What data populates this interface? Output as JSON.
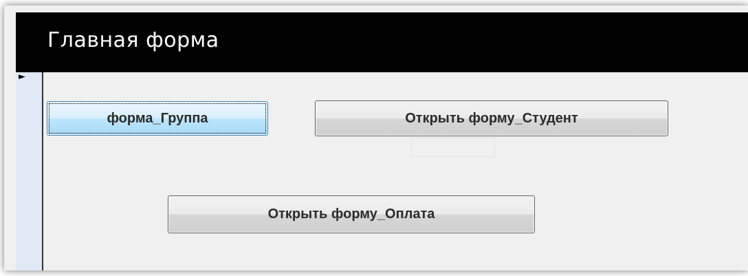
{
  "form": {
    "title": "Главная форма",
    "record_selector_icon": "triangle-right-icon"
  },
  "buttons": {
    "group": "форма_Группа",
    "student": "Открыть форму_Студент",
    "payment": "Открыть форму_Оплата"
  },
  "colors": {
    "header_bg": "#000000",
    "form_bg": "#f0f0f0",
    "focused_button": "#bee6fd"
  }
}
